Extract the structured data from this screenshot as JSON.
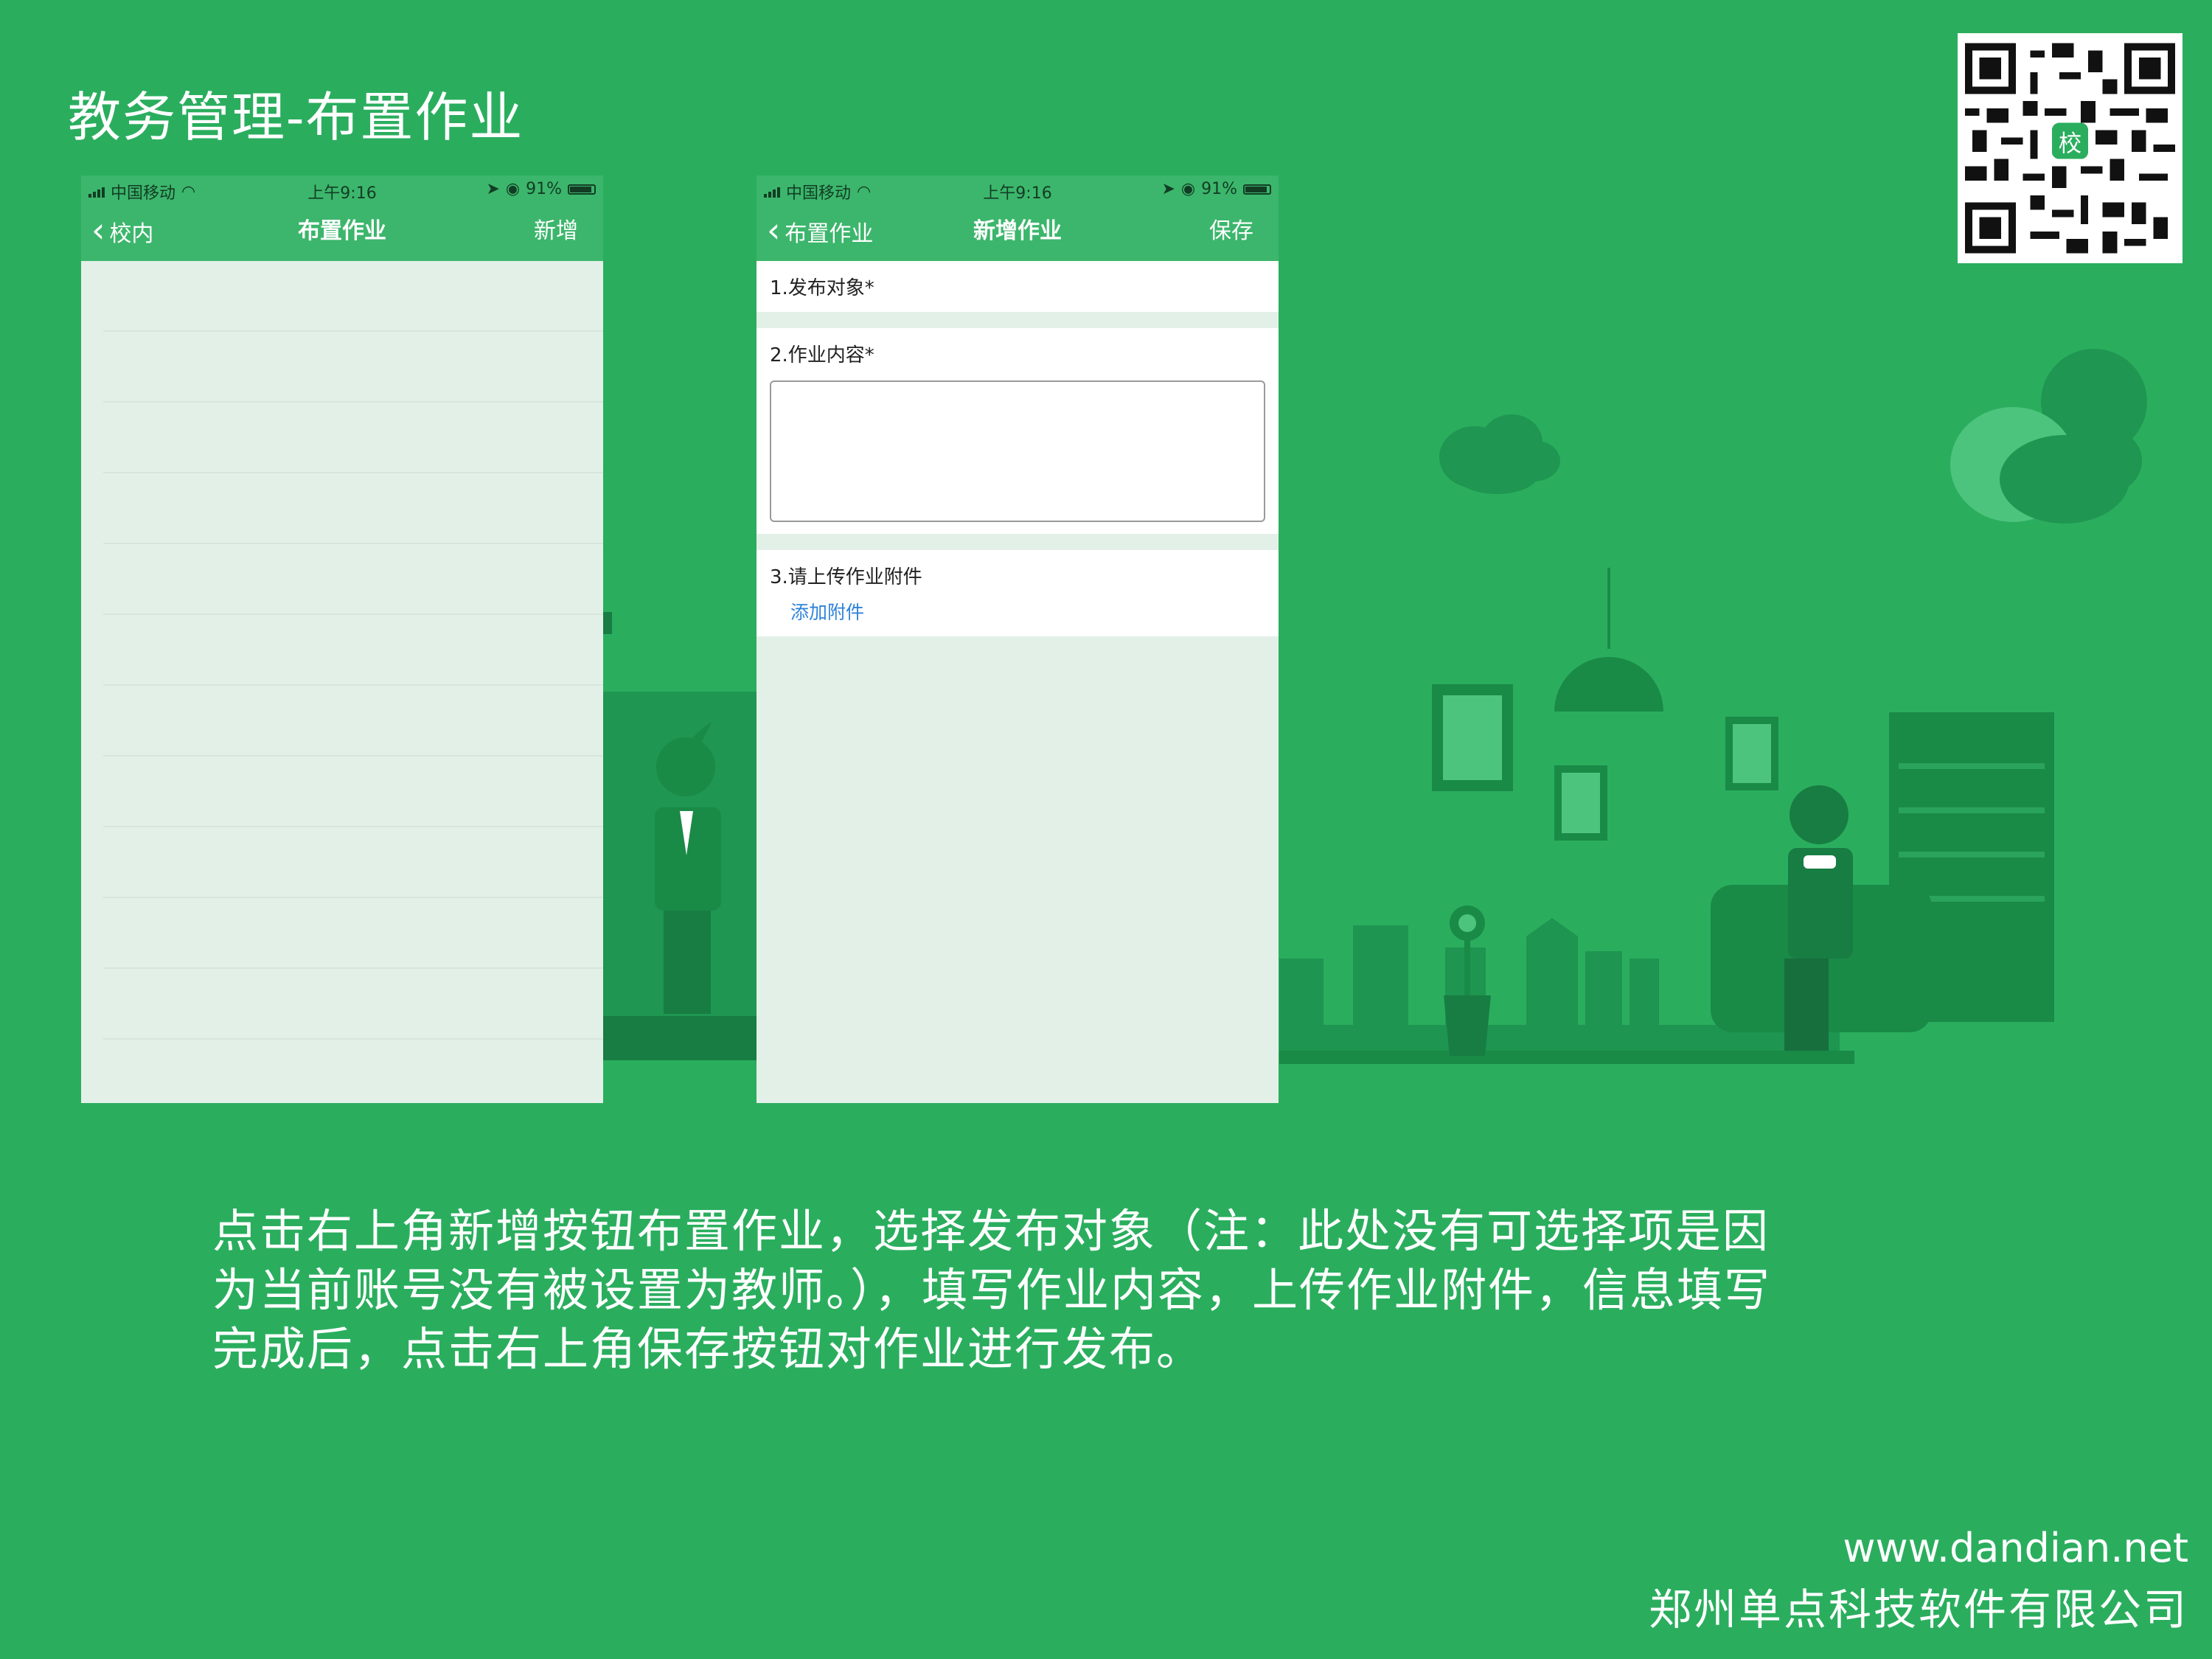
{
  "slide": {
    "title": "教务管理-布置作业",
    "description": "点击右上角新增按钮布置作业，选择发布对象（注：此处没有可选择项是因为当前账号没有被设置为教师。），填写作业内容，上传作业附件，信息填写完成后，点击右上角保存按钮对作业进行发布。",
    "footer_url": "www.dandian.net",
    "footer_company": "郑州单点科技软件有限公司",
    "qr_badge": "校"
  },
  "phone1": {
    "status": {
      "carrier": "中国移动",
      "time": "上午9:16",
      "battery": "91%",
      "battery_level": 0.91
    },
    "nav": {
      "back": "校内",
      "title": "布置作业",
      "action": "新增"
    },
    "row_count": 12
  },
  "phone2": {
    "status": {
      "carrier": "中国移动",
      "time": "上午9:16",
      "battery": "91%",
      "battery_level": 0.91
    },
    "nav": {
      "back": "布置作业",
      "title": "新增作业",
      "action": "保存"
    },
    "form": {
      "target_label": "1.发布对象*",
      "content_label": "2.作业内容*",
      "content_value": "",
      "attachment_label": "3.请上传作业附件",
      "attachment_link": "添加附件"
    }
  },
  "colors": {
    "background": "#2aae5e",
    "navbar": "#3cb66c",
    "phone_body": "#e3f0e8",
    "scene_dark": "#1c8a48",
    "link": "#2f83d9"
  }
}
